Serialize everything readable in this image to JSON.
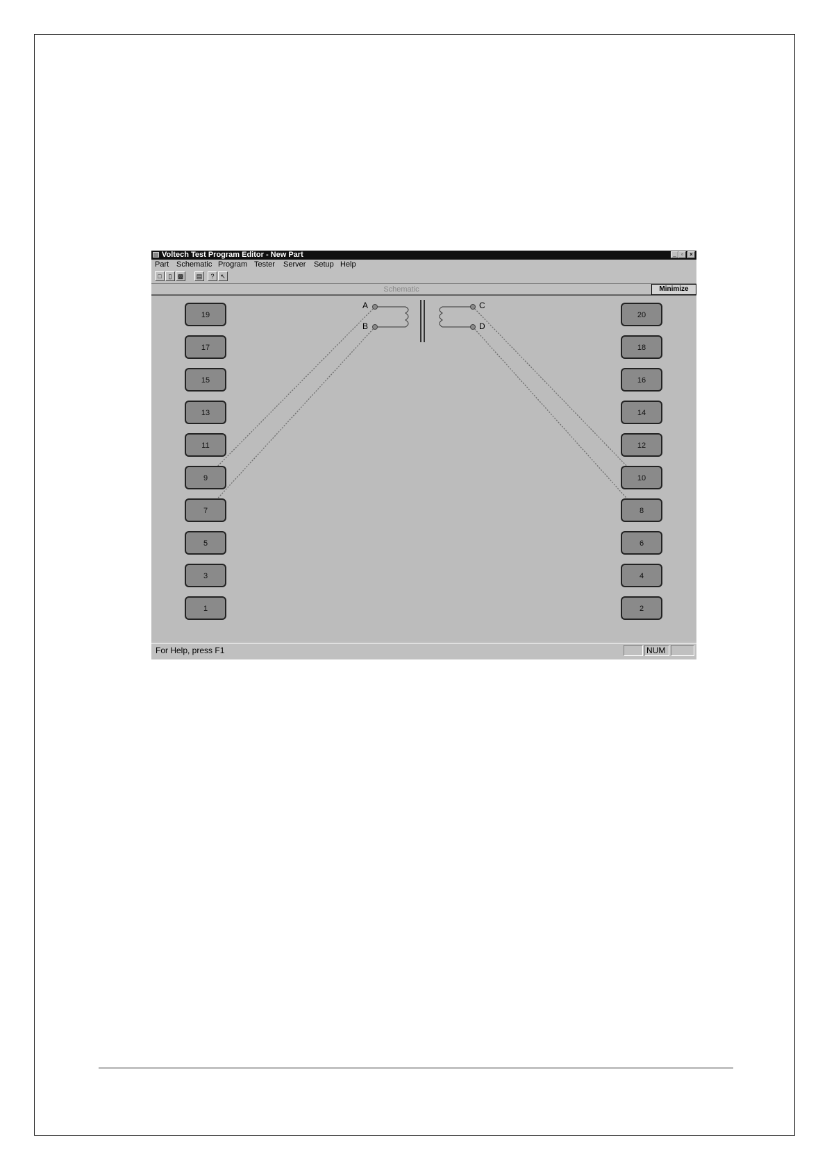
{
  "window": {
    "title": "Voltech Test Program Editor - New Part",
    "controls": [
      "_",
      "▫",
      "×"
    ]
  },
  "menu": [
    "Part",
    "Schematic",
    "Program",
    "Tester",
    "Server",
    "Setup",
    "Help"
  ],
  "toolbar": {
    "buttons": [
      "new-icon",
      "open-icon",
      "save-icon",
      "print-icon",
      "help-icon",
      "context-help-icon"
    ]
  },
  "panel": {
    "title": "Schematic",
    "minimize_label": "Minimize"
  },
  "schematic": {
    "left_pins": [
      "19",
      "17",
      "15",
      "13",
      "11",
      "9",
      "7",
      "5",
      "3",
      "1"
    ],
    "right_pins": [
      "20",
      "18",
      "16",
      "14",
      "12",
      "10",
      "8",
      "6",
      "4",
      "2"
    ],
    "terminals": {
      "a": "A",
      "b": "B",
      "c": "C",
      "d": "D"
    },
    "connections": [
      {
        "terminal": "A",
        "pin": "9"
      },
      {
        "terminal": "B",
        "pin": "7"
      },
      {
        "terminal": "C",
        "pin": "10"
      },
      {
        "terminal": "D",
        "pin": "8"
      }
    ]
  },
  "status": {
    "help_text": "For Help, press F1",
    "num_indicator": "NUM"
  },
  "colors": {
    "pin_fill": "#8a8a8a",
    "canvas": "#bcbcbc",
    "title_bar": "#101010"
  }
}
